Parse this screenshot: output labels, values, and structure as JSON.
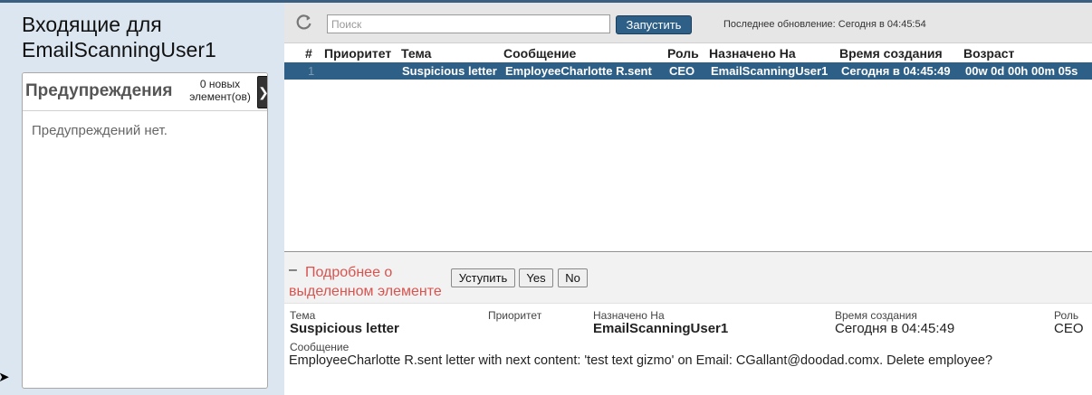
{
  "sidebar": {
    "inbox_title": "Входящие для EmailScanningUser1",
    "alerts": {
      "title": "Предупреждения",
      "count_label": "0 новых элемент(ов)",
      "empty_text": "Предупреждений нет."
    }
  },
  "toolbar": {
    "search_placeholder": "Поиск",
    "run_label": "Запустить",
    "last_updated": "Последнее обновление: Сегодня в 04:45:54"
  },
  "grid": {
    "columns": [
      "#",
      "Приоритет",
      "Тема",
      "Сообщение",
      "Роль",
      "Назначено На",
      "Время создания",
      "Возраст"
    ],
    "rows": [
      {
        "num": "1",
        "priority": "",
        "subject": "Suspicious letter",
        "message": "EmployeeCharlotte R.sent",
        "role": "CEO",
        "assigned_to": "EmailScanningUser1",
        "created": "Сегодня в 04:45:49",
        "age": "00w 0d 00h 00m 05s"
      }
    ]
  },
  "detail": {
    "collapse_symbol": "–",
    "title": "Подробнее о выделенном элементе",
    "buttons": {
      "yield": "Уступить",
      "yes": "Yes",
      "no": "No"
    },
    "subject_label": "Тема",
    "subject_value": "Suspicious letter",
    "priority_label": "Приоритет",
    "assigned_label": "Назначено На",
    "assigned_value": "EmailScanningUser1",
    "created_label": "Время создания",
    "created_value": "Сегодня в 04:45:49",
    "role_label": "Роль",
    "role_value": "CEO",
    "message_label": "Сообщение",
    "message_value": "EmployeeCharlotte R.sent letter with next content: 'test text gizmo' on Email: CGallant@doodad.comx. Delete employee?"
  },
  "icons": {
    "refresh": "refresh-icon",
    "alerts_toggle": "chevron-right-icon",
    "side_arrow": "arrow-right-icon"
  },
  "colors": {
    "accent": "#2e5f86",
    "sidebar_bg": "#dce6f0",
    "detail_title": "#d9534f"
  }
}
